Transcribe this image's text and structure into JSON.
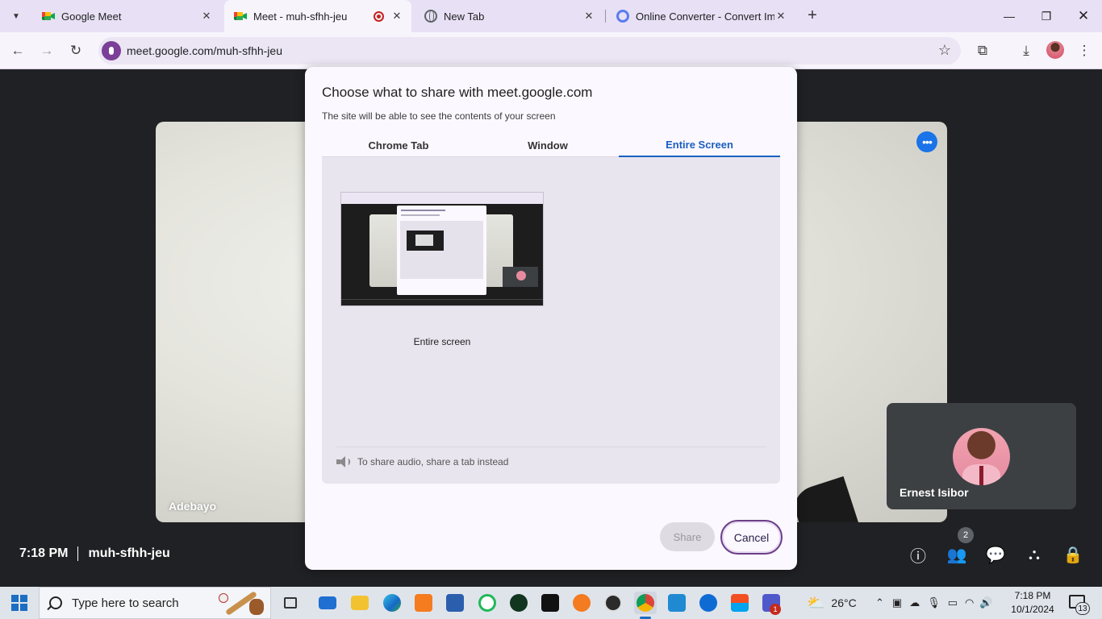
{
  "browser": {
    "tabs": [
      {
        "title": "Google Meet",
        "favicon": "google-meet-icon",
        "active": false
      },
      {
        "title": "Meet - muh-sfhh-jeu",
        "favicon": "google-meet-icon",
        "active": true,
        "recording": true
      },
      {
        "title": "New Tab",
        "favicon": "globe-icon",
        "active": false
      },
      {
        "title": "Online Converter - Convert Ima",
        "favicon": "converter-icon",
        "active": false
      }
    ],
    "url": "meet.google.com/muh-sfhh-jeu"
  },
  "meet": {
    "main_participant": "Adebayo",
    "self_participant": "Ernest Isibor",
    "time": "7:18 PM",
    "meeting_code": "muh-sfhh-jeu",
    "people_count": "2",
    "accent_color": "#1a73e8"
  },
  "share_dialog": {
    "title": "Choose what to share with meet.google.com",
    "subtitle": "The site will be able to see the contents of your screen",
    "tabs": [
      {
        "label": "Chrome Tab",
        "active": false
      },
      {
        "label": "Window",
        "active": false
      },
      {
        "label": "Entire Screen",
        "active": true
      }
    ],
    "screen_option_label": "Entire screen",
    "audio_note": "To share audio, share a tab instead",
    "share_button": "Share",
    "cancel_button": "Cancel",
    "active_tab_color": "#1a5fc0"
  },
  "taskbar": {
    "search_placeholder": "Type here to search",
    "weather": "26°C",
    "time": "7:18 PM",
    "date": "10/1/2024",
    "notification_count": "13",
    "teams_badge": "1"
  }
}
